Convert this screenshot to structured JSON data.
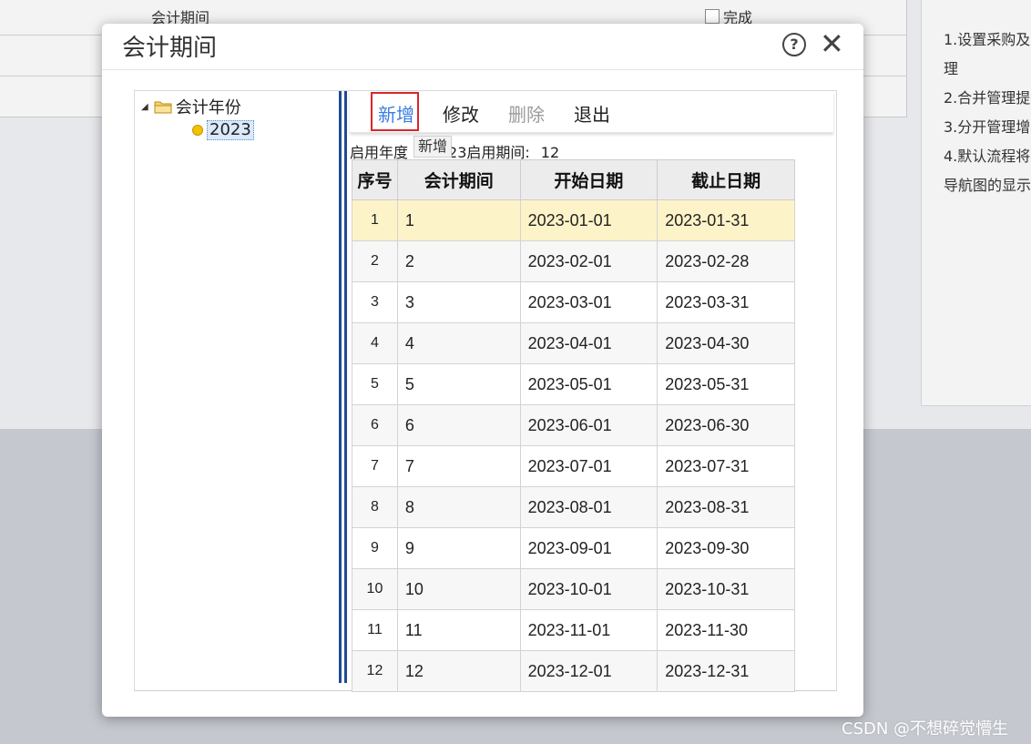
{
  "background": {
    "period_label": "会计期间",
    "done_label": "完成",
    "side_items": [
      "1.设置采购及",
      "理",
      "2.合并管理提",
      "3.分开管理增",
      "4.默认流程将",
      "导航图的显示"
    ]
  },
  "dialog": {
    "title": "会计期间",
    "help_icon": "?",
    "close_icon": "✕"
  },
  "tree": {
    "root_label": "会计年份",
    "child_label": "2023"
  },
  "toolbar": {
    "add": "新增",
    "edit": "修改",
    "delete": "删除",
    "exit": "退出",
    "tooltip": "新增"
  },
  "info": {
    "year_label": "启用年度",
    "year_partial": "23",
    "period_label": "启用期间:",
    "period_value": "12"
  },
  "table": {
    "headers": [
      "序号",
      "会计期间",
      "开始日期",
      "截止日期"
    ],
    "rows": [
      [
        "1",
        "1",
        "2023-01-01",
        "2023-01-31"
      ],
      [
        "2",
        "2",
        "2023-02-01",
        "2023-02-28"
      ],
      [
        "3",
        "3",
        "2023-03-01",
        "2023-03-31"
      ],
      [
        "4",
        "4",
        "2023-04-01",
        "2023-04-30"
      ],
      [
        "5",
        "5",
        "2023-05-01",
        "2023-05-31"
      ],
      [
        "6",
        "6",
        "2023-06-01",
        "2023-06-30"
      ],
      [
        "7",
        "7",
        "2023-07-01",
        "2023-07-31"
      ],
      [
        "8",
        "8",
        "2023-08-01",
        "2023-08-31"
      ],
      [
        "9",
        "9",
        "2023-09-01",
        "2023-09-30"
      ],
      [
        "10",
        "10",
        "2023-10-01",
        "2023-10-31"
      ],
      [
        "11",
        "11",
        "2023-11-01",
        "2023-11-30"
      ],
      [
        "12",
        "12",
        "2023-12-01",
        "2023-12-31"
      ]
    ],
    "selected_row": 0
  },
  "watermark": "CSDN @不想碎觉懵生",
  "colors": {
    "accent": "#3b7de0",
    "highlight_box": "#d9262b",
    "selected_row": "#fdf3c8",
    "splitter": "#1d4b94"
  }
}
